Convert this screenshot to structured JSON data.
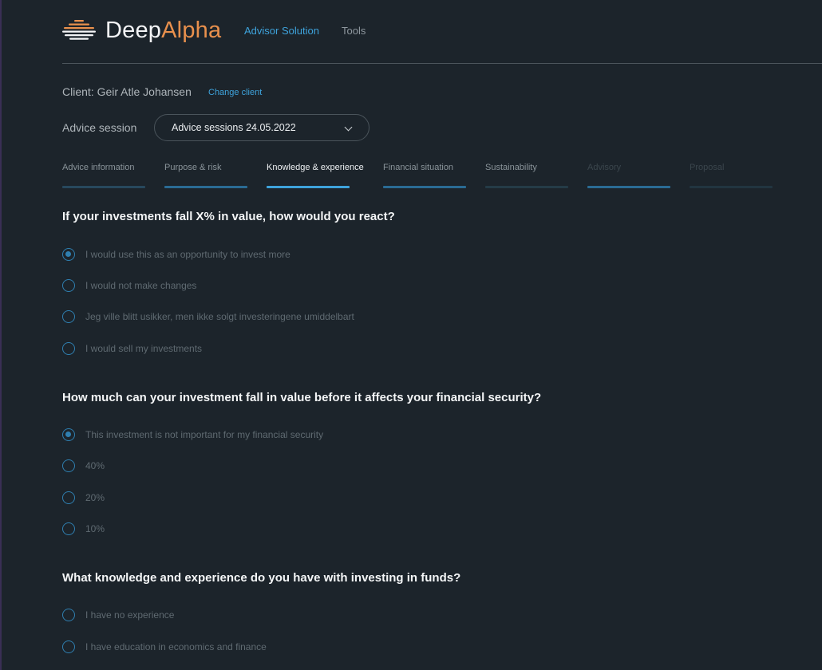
{
  "header": {
    "logo_word_1": "Deep",
    "logo_word_2": "Alpha",
    "nav": [
      {
        "label": "Advisor Solution",
        "active": true
      },
      {
        "label": "Tools",
        "active": false
      }
    ]
  },
  "client": {
    "label": "Client: Geir Atle Johansen",
    "change_label": "Change client"
  },
  "session": {
    "label": "Advice session",
    "selected": "Advice sessions 24.05.2022"
  },
  "steps": [
    {
      "label": "Advice information",
      "state": "done"
    },
    {
      "label": "Purpose & risk",
      "state": "done"
    },
    {
      "label": "Knowledge & experience",
      "state": "current"
    },
    {
      "label": "Financial situation",
      "state": "done"
    },
    {
      "label": "Sustainability",
      "state": "pending"
    },
    {
      "label": "Advisory",
      "state": "done-disabled"
    },
    {
      "label": "Proposal",
      "state": "disabled"
    }
  ],
  "questions": [
    {
      "text": "If your investments fall X% in value, how would you react?",
      "options": [
        {
          "label": "I would use this as an opportunity to invest more",
          "checked": true
        },
        {
          "label": "I would not make changes",
          "checked": false
        },
        {
          "label": "Jeg ville blitt usikker, men ikke solgt investeringene umiddelbart",
          "checked": false
        },
        {
          "label": "I would sell my investments",
          "checked": false
        }
      ]
    },
    {
      "text": "How much can your investment fall in value before it affects your financial security?",
      "options": [
        {
          "label": "This investment is not important for my financial security",
          "checked": true
        },
        {
          "label": "40%",
          "checked": false
        },
        {
          "label": "20%",
          "checked": false
        },
        {
          "label": "10%",
          "checked": false
        }
      ]
    },
    {
      "text": "What knowledge and experience do you have with investing in funds?",
      "options": [
        {
          "label": "I have no experience",
          "checked": false
        },
        {
          "label": "I have education in economics and finance",
          "checked": false
        }
      ]
    }
  ],
  "colors": {
    "background": "#1c242b",
    "accent": "#3ea3dc",
    "logo_accent": "#e8904d",
    "radio": "#2f7fb0"
  }
}
